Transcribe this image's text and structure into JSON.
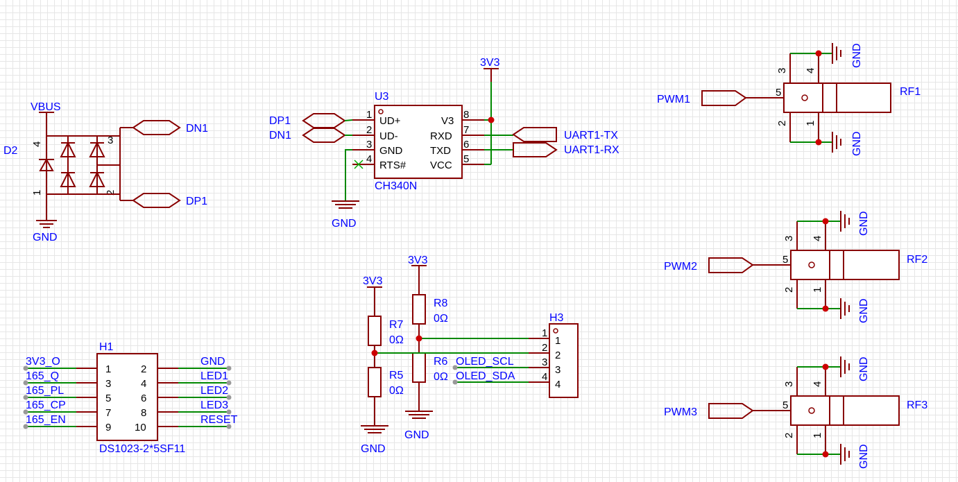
{
  "nets": {
    "vbus": "VBUS",
    "gnd": "GND",
    "v3": "3V3",
    "dn1": "DN1",
    "dp1": "DP1",
    "uart_tx": "UART1-TX",
    "uart_rx": "UART1-RX",
    "pwm1": "PWM1",
    "pwm2": "PWM2",
    "pwm3": "PWM3",
    "oled_scl": "OLED_SCL",
    "oled_sda": "OLED_SDA",
    "h1_left": [
      "3V3_O",
      "165_Q",
      "165_PL",
      "165_CP",
      "165_EN"
    ],
    "h1_right": [
      "GND",
      "LED1",
      "LED2",
      "LED3",
      "RESET"
    ]
  },
  "components": {
    "d2": {
      "ref": "D2",
      "pins": [
        "4",
        "1",
        "3",
        "2"
      ]
    },
    "u3": {
      "ref": "U3",
      "part": "CH340N",
      "left_pins": [
        {
          "num": "1",
          "name": "UD+"
        },
        {
          "num": "2",
          "name": "UD-"
        },
        {
          "num": "3",
          "name": "GND"
        },
        {
          "num": "4",
          "name": "RTS#"
        }
      ],
      "right_pins": [
        {
          "num": "8",
          "name": "V3"
        },
        {
          "num": "7",
          "name": "RXD"
        },
        {
          "num": "6",
          "name": "TXD"
        },
        {
          "num": "5",
          "name": "VCC"
        }
      ]
    },
    "h1": {
      "ref": "H1",
      "part": "DS1023-2*5SF11",
      "left_nums": [
        "1",
        "3",
        "5",
        "7",
        "9"
      ],
      "right_nums": [
        "2",
        "4",
        "6",
        "8",
        "10"
      ]
    },
    "h3": {
      "ref": "H3",
      "pins": [
        "1",
        "2",
        "3",
        "4"
      ]
    },
    "r5": {
      "ref": "R5",
      "value": "0Ω"
    },
    "r6": {
      "ref": "R6",
      "value": "0Ω"
    },
    "r7": {
      "ref": "R7",
      "value": "0Ω"
    },
    "r8": {
      "ref": "R8",
      "value": "0Ω"
    },
    "rf1": {
      "ref": "RF1"
    },
    "rf2": {
      "ref": "RF2"
    },
    "rf3": {
      "ref": "RF3"
    },
    "rf_pins": [
      "3",
      "4",
      "5",
      "2",
      "1"
    ]
  },
  "colors": {
    "wire": "#008800",
    "symbol": "#880000",
    "label": "#0000ff",
    "junction": "#cc0000"
  }
}
